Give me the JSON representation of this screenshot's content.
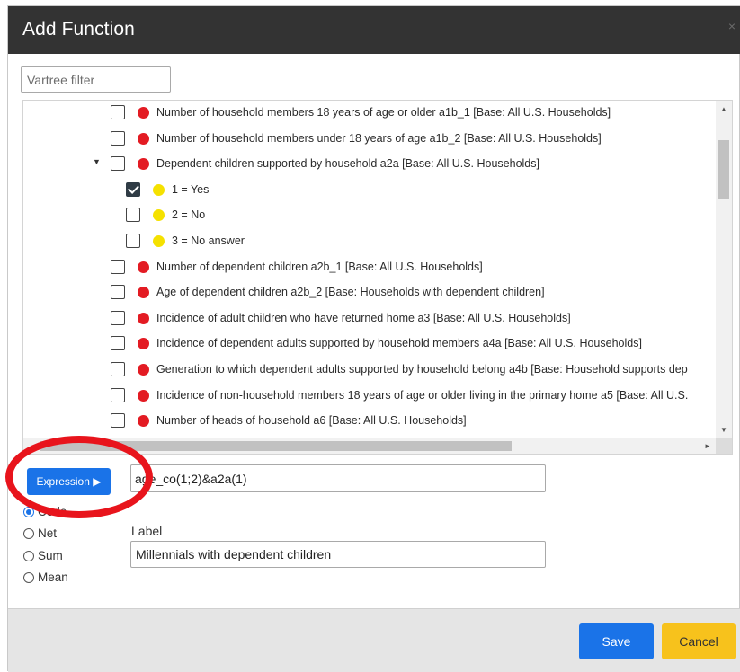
{
  "dialog": {
    "title": "Add Function",
    "close_glyph": "×"
  },
  "filter": {
    "placeholder": "Vartree filter",
    "value": ""
  },
  "tree": {
    "rows": [
      {
        "text": "Number of household members 18 years of age or older a1b_1 [Base: All U.S. Households]",
        "dot": "red",
        "checked": false,
        "expander": ""
      },
      {
        "text": "Number of household members under 18 years of age a1b_2 [Base: All U.S. Households]",
        "dot": "red",
        "checked": false,
        "expander": ""
      },
      {
        "text": "Dependent children supported by household a2a [Base: All U.S. Households]",
        "dot": "red",
        "checked": false,
        "expander": "▼"
      },
      {
        "text": "1 = Yes",
        "dot": "yellow",
        "checked": true,
        "expander": ""
      },
      {
        "text": "2 = No",
        "dot": "yellow",
        "checked": false,
        "expander": ""
      },
      {
        "text": "3 = No answer",
        "dot": "yellow",
        "checked": false,
        "expander": ""
      },
      {
        "text": "Number of dependent children a2b_1 [Base: All U.S. Households]",
        "dot": "red",
        "checked": false,
        "expander": ""
      },
      {
        "text": "Age of dependent children a2b_2 [Base: Households with dependent children]",
        "dot": "red",
        "checked": false,
        "expander": ""
      },
      {
        "text": "Incidence of adult children who have returned home a3 [Base: All U.S. Households]",
        "dot": "red",
        "checked": false,
        "expander": ""
      },
      {
        "text": "Incidence of dependent adults supported by household members a4a [Base: All U.S. Households]",
        "dot": "red",
        "checked": false,
        "expander": ""
      },
      {
        "text": "Generation to which dependent adults supported by household belong a4b [Base: Household supports dep",
        "dot": "red",
        "checked": false,
        "expander": ""
      },
      {
        "text": "Incidence of non-household members 18 years of age or older living in the primary home a5 [Base: All U.S.",
        "dot": "red",
        "checked": false,
        "expander": ""
      },
      {
        "text": "Number of heads of household a6 [Base: All U.S. Households]",
        "dot": "red",
        "checked": false,
        "expander": ""
      }
    ],
    "scroll_up": "▲",
    "scroll_down": "▼",
    "scroll_right": "►"
  },
  "expression": {
    "button_label": "Expression ▶",
    "value": "age_co(1;2)&a2a(1)"
  },
  "type_options": [
    {
      "label": "Code",
      "selected": true
    },
    {
      "label": "Net",
      "selected": false
    },
    {
      "label": "Sum",
      "selected": false
    },
    {
      "label": "Mean",
      "selected": false
    }
  ],
  "label_field": {
    "caption": "Label",
    "value": "Millennials with dependent children"
  },
  "footer": {
    "save_label": "Save",
    "cancel_label": "Cancel"
  },
  "colors": {
    "titlebar": "#333333",
    "primary": "#1a73e8",
    "cancel": "#f7c21c",
    "highlight_ring": "#e8141c",
    "dot_red": "#e31b23",
    "dot_yellow": "#f5e100"
  }
}
